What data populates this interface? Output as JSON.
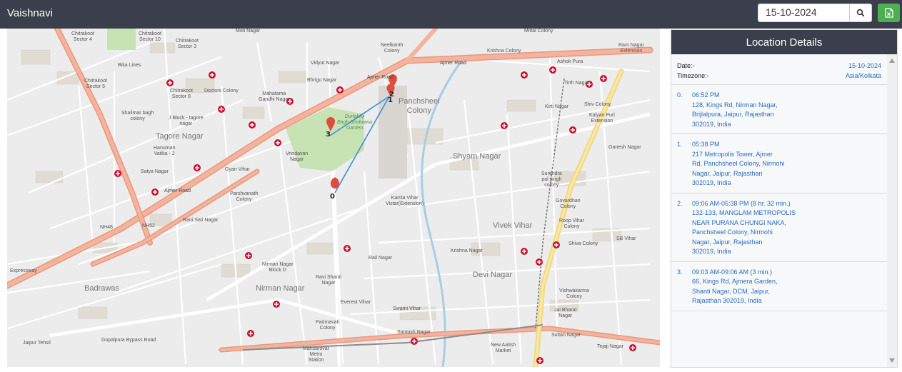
{
  "header": {
    "title": "Vaishnavi",
    "date_value": "15-10-2024",
    "search_icon": "search-icon",
    "export_icon": "excel-export-icon"
  },
  "colors": {
    "topbar": "#3a3f4b",
    "accent_green": "#4caf50",
    "link_blue": "#2a6cc0",
    "route_blue": "#3a8fd9",
    "marker_red": "#e04b3f",
    "major_road": "#f0a58e"
  },
  "map": {
    "labels": {
      "chitrakoot_s4": "Chitrakoot\nSector 4",
      "chitrakoot_s10": "Chitrakoot\nSector 10",
      "chitrakoot_s3": "Chitrakoot\nSector 3",
      "moti_nagar": "Moti Nagar",
      "neelkanth": "Neelkanth\nColony",
      "mittal": "Mittal Colony",
      "krishna_colony": "Krishna Colony",
      "ram_nagar": "Ram Nagar\nExtension",
      "ashok_pura": "Ashok Pura",
      "bika_lines": "Bika Lines",
      "chitrakoot_s5": "Chitrakoot\nSector 5",
      "chitrakoot_s8": "Chitrakoot\nSector 8",
      "doctors": "Doctors Colony",
      "mahatama": "Mahatama\nGandhi Nagar",
      "vidyut": "Vidyut Nagar",
      "bhrigu": "Bhrigu Nagar",
      "ajmer_road_top": "Ajmer Road",
      "ajmer_road_mid": "Ajmer Road",
      "ajmer_road_low": "Ajmer Road",
      "panchsheel": "Panchsheel\nColony",
      "tirth": "Tirth Nagar",
      "kirti": "Kirti Nagar",
      "shiv": "Shiv Colony",
      "kalyan": "Kalyan Puri\nExtension",
      "shalimar": "Shalimar bagh\ncolony",
      "jblock": "J Block - tagore\nnagar",
      "tagore": "Tagore Nagar",
      "durlabhji": "Durlabhji\nBagh Sindwaria\nGarden",
      "hanuman": "Hanuman\nVatika - 2",
      "vrindavan": "Vrindavan\nNagar",
      "shyam": "Shyam Nagar",
      "ganesh": "Ganesh Nagar",
      "satya": "Satya Nagar",
      "gyan": "Gyan Vihar",
      "surendra": "Surendra\npal singh\ncolony",
      "parshvanath": "Parshvanath\nColony",
      "kamla": "Kamla Vihar\nVistar(Extension)",
      "govardhan": "Govardhan\nColony",
      "rani_sati": "Rani Sati Nagar",
      "roop": "Roop Vihar\nColony",
      "vivek": "Vivek Vihar",
      "nh48": "NH48",
      "nh52": "NH52",
      "krishna_nagar": "Krishna Nagar",
      "shiva_colony": "Shiva Colony",
      "sb_vihar": "SB Vihar",
      "nirman_block": "Nirman Nagar\nBlock D",
      "ravi": "Ravi Shanti\nNagar",
      "rail_nagar": "Rail Nagar",
      "devi": "Devi Nagar",
      "badrawas": "Badrawas",
      "nirman_nagar": "Nirman Nagar",
      "everest": "Everest Vihar",
      "swami": "Swami Vihar",
      "vishwakarma": "Vishwakarma\nColony",
      "jai_bharat": "Jai Bharat\nNagar",
      "padmavati": "Padmavati\nColony",
      "santosh": "Santosh Nagar",
      "sultan": "Sultan Nagar",
      "tejaji": "Tejaji Nagar",
      "gopalpura": "Gopalpura Bypass Road",
      "mansarovar": "Mansarovar\nMetro\nStation",
      "new_aatish": "New Aatish\nMarket",
      "expressway": "Expressway",
      "jaipur_tehsil": "Jaipur Tehsil"
    },
    "markers": [
      {
        "label": "0"
      },
      {
        "label": "1"
      },
      {
        "label": "2"
      },
      {
        "label": "3"
      }
    ]
  },
  "panel": {
    "title": "Location Details",
    "date_label": "Date:-",
    "date_value": "15-10-2024",
    "timezone_label": "Timezone:-",
    "timezone_value": "Asia/Kolkata",
    "entries": [
      {
        "num": "0.",
        "time": "06:52 PM",
        "address": "128, Kings Rd, Nirman Nagar,\nBrijlalpura, Jaipur, Rajasthan\n302019, India"
      },
      {
        "num": "1.",
        "time": "05:38 PM",
        "address": "217 Metropolis Tower, Ajmer\nRd, Panchsheel Colony, Nirmohi\nNagar, Jaipur, Rajasthan\n302019, India"
      },
      {
        "num": "2.",
        "time": "09:06 AM-05:38 PM (8 hr. 32 min.)",
        "address": "132-133, MANGLAM METROPOLIS\nNEAR PURANA CHUNGI NAKA,\nPanchsheel Colony, Nirmohi\nNagar, Jaipur, Rajasthan\n302019, India"
      },
      {
        "num": "3.",
        "time": "09:03 AM-09:06 AM (3 min.)",
        "address": "66, Kings Rd, Ajmera Garden,\nShanti Nagar, DCM, Jaipur,\nRajasthan 302019, India"
      }
    ]
  }
}
